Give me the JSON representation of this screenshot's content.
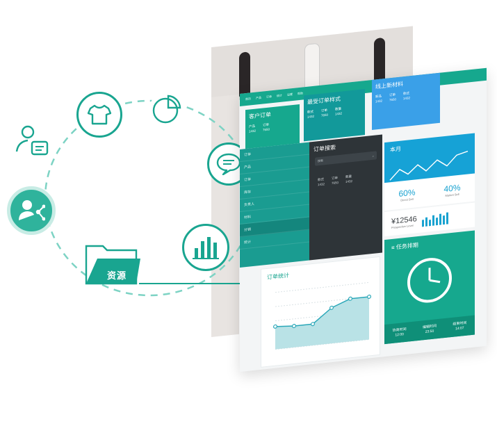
{
  "colors": {
    "accent": "#19a590",
    "accent_light": "#c8ece5",
    "dark": "#2e3438",
    "blue": "#16a2d6",
    "teal_menu": "#1a9c91"
  },
  "folder": {
    "label": "资源",
    "icon": "folder-icon"
  },
  "icons": [
    "tshirt-icon",
    "pie-chart-icon",
    "user-message-icon",
    "share-user-icon",
    "chat-bubble-icon",
    "bar-chart-icon"
  ],
  "dashboard": {
    "top_links": [
      "首页",
      "产品",
      "订单",
      "统计",
      "设置",
      "帮助"
    ],
    "cards": [
      {
        "title": "客户订单",
        "cols": [
          [
            "产品",
            "1432"
          ],
          [
            "订单",
            "7650"
          ]
        ]
      },
      {
        "title": "最受订单样式",
        "cols": [
          [
            "款式",
            "1432"
          ],
          [
            "订单",
            "7650"
          ],
          [
            "数量",
            "1432"
          ]
        ]
      },
      {
        "title": "线上新材料",
        "cols": [
          [
            "新品",
            "1432"
          ],
          [
            "订单",
            "7650"
          ],
          [
            "款式",
            "1432"
          ]
        ]
      }
    ],
    "menu": [
      "订单",
      "产品",
      "订单",
      "库存",
      "负责人",
      "材料",
      "分销",
      "统计"
    ],
    "search": {
      "title": "订单搜索",
      "placeholder": "搜索",
      "cols": [
        [
          "款式",
          "1432"
        ],
        [
          "订单",
          "7650"
        ],
        [
          "数量",
          "1432"
        ]
      ]
    },
    "stats": {
      "title": "本月",
      "pct1": "60%",
      "pct1_label": "Direct Sell",
      "pct2": "40%",
      "pct2_label": "Market Sell"
    },
    "money": {
      "value": "¥12546",
      "label": "Prospective Level"
    },
    "chart": {
      "title": "订单统计"
    },
    "plan": {
      "title": "任务排期",
      "cols": [
        [
          "协商时间",
          "12:00"
        ],
        [
          "编辑时间",
          "23:50"
        ],
        [
          "结束时间",
          "14:07"
        ]
      ]
    }
  },
  "chart_data": {
    "type": "area",
    "x": [
      1,
      2,
      3,
      4,
      5,
      6
    ],
    "values": [
      16,
      15,
      15,
      25,
      30,
      30
    ],
    "ylim": [
      0,
      40
    ]
  }
}
